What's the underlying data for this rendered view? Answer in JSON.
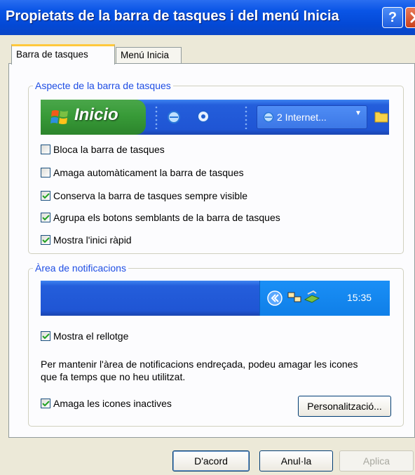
{
  "window": {
    "title": "Propietats de la barra de tasques i del menú Inicia",
    "help_label": "?"
  },
  "tabs": [
    {
      "label": "Barra de tasques",
      "active": true
    },
    {
      "label": "Menú Inicia",
      "active": false
    }
  ],
  "appearance": {
    "group_title": "Aspecte de la barra de tasques",
    "preview": {
      "start_label": "Inicio",
      "task_label": "2 Internet..."
    },
    "options": [
      {
        "label": "Bloca la barra de tasques",
        "checked": false
      },
      {
        "label": "Amaga automàticament la barra de tasques",
        "checked": false
      },
      {
        "label": "Conserva la barra de tasques sempre visible",
        "checked": true
      },
      {
        "label": "Agrupa els botons semblants de la barra de tasques",
        "checked": true
      },
      {
        "label": "Mostra l'inici ràpid",
        "checked": true
      }
    ]
  },
  "notifications": {
    "group_title": "Àrea de notificacions",
    "clock_time": "15:35",
    "show_clock": {
      "label": "Mostra el rellotge",
      "checked": true
    },
    "info_text": "Per mantenir l'àrea de notificacions endreçada, podeu amagar les icones que fa temps que no heu utilitzat.",
    "hide_inactive": {
      "label": "Amaga les icones inactives",
      "checked": true
    },
    "customize_label": "Personalització..."
  },
  "buttons": {
    "ok": "D'acord",
    "cancel": "Anul·la",
    "apply": "Aplica"
  },
  "colors": {
    "titlebar": "#0a55e6",
    "dialog_bg": "#ece9d8",
    "group_title": "#1f4ee4",
    "start_green": "#389b38",
    "taskbar_blue": "#245edb",
    "check_green": "#21a121"
  }
}
